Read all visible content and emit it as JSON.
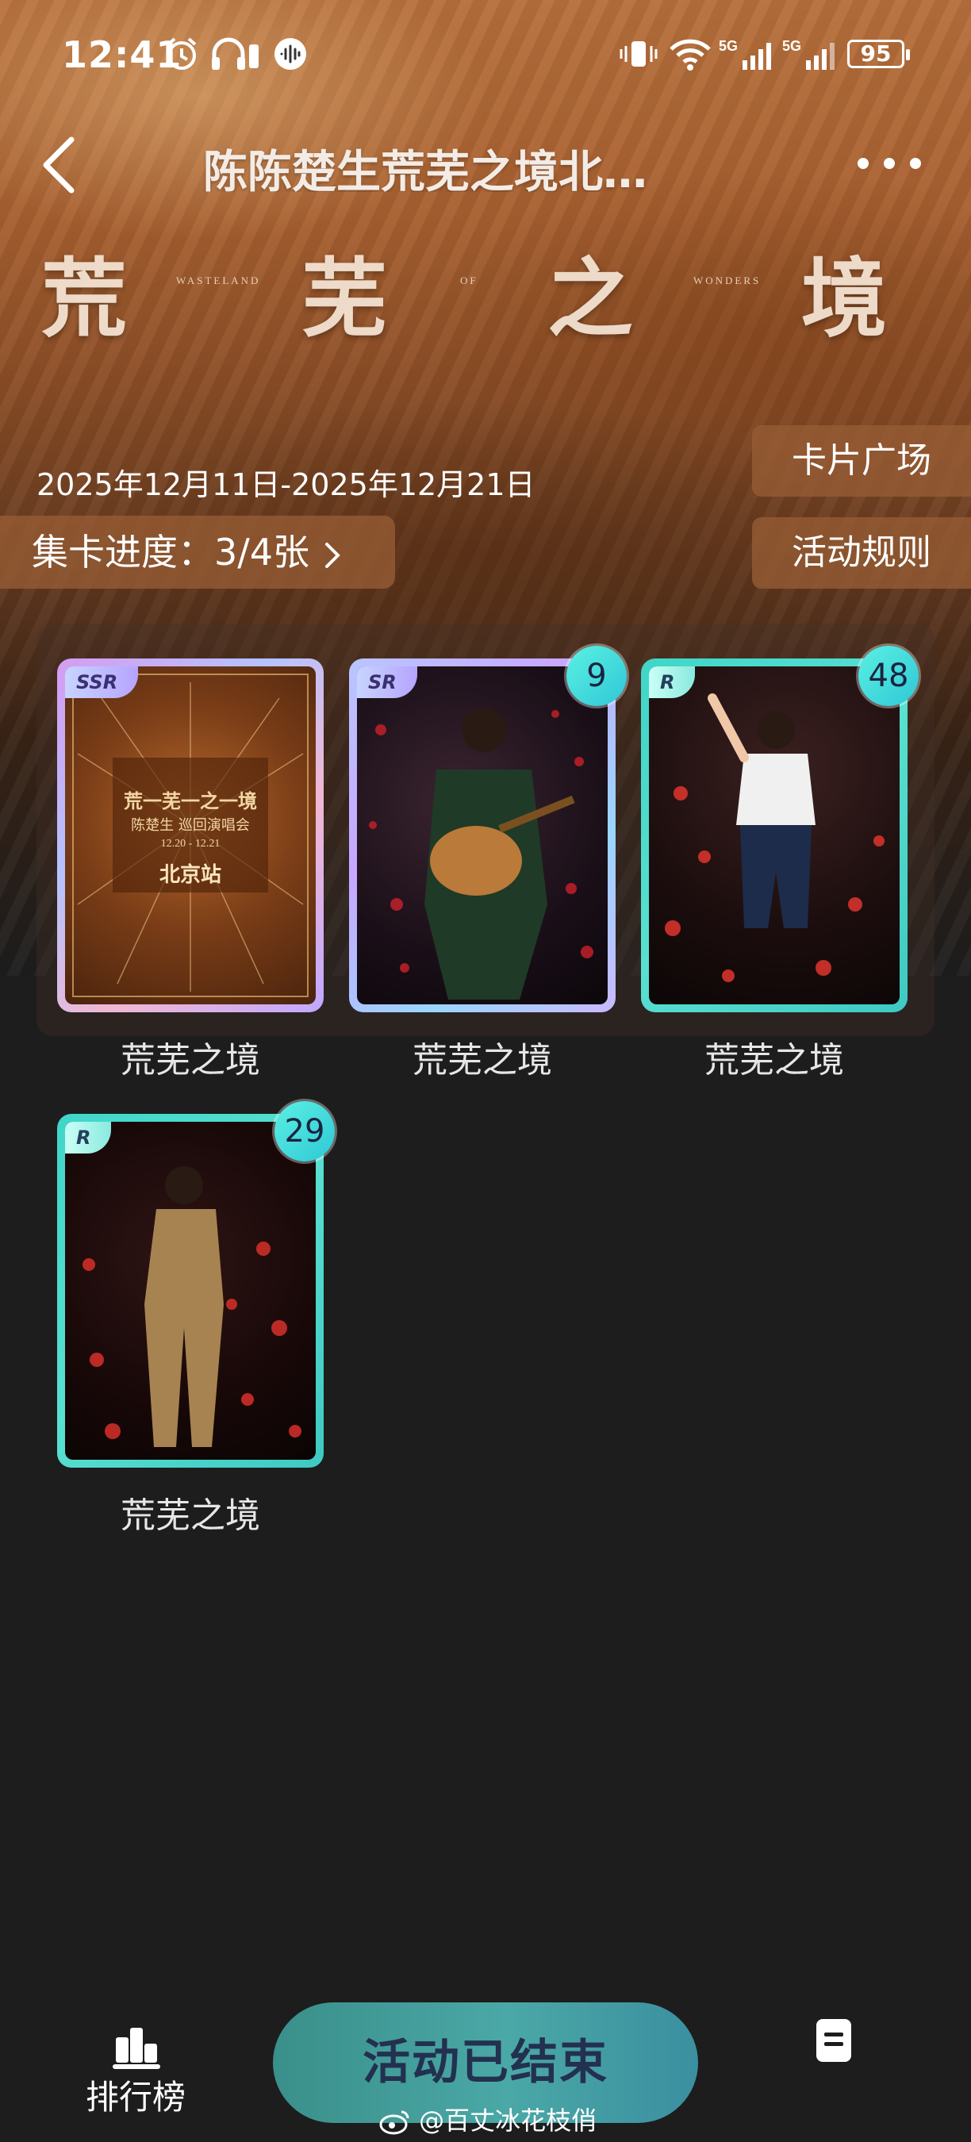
{
  "status_bar": {
    "time": "12:41",
    "battery": "95",
    "network": "5G"
  },
  "header": {
    "title": "陈陈楚生荒芜之境北…"
  },
  "banner": {
    "characters": [
      "荒",
      "芜",
      "之",
      "境"
    ],
    "english_words": [
      "WASTELAND",
      "OF",
      "WONDERS"
    ]
  },
  "event": {
    "date_range": "2025年12月11日-2025年12月21日",
    "progress_label": "集卡进度：3/4张",
    "card_plaza": "卡片广场",
    "rules": "活动规则"
  },
  "cards": [
    {
      "rarity": "SSR",
      "name": "荒芜之境",
      "count": null,
      "poster": {
        "title": "荒一芜一之一境",
        "subtitle": "陈楚生 巡回演唱会",
        "dates": "12.20  -  12.21",
        "station": "北京站"
      }
    },
    {
      "rarity": "SR",
      "name": "荒芜之境",
      "count": "9"
    },
    {
      "rarity": "R",
      "name": "荒芜之境",
      "count": "48"
    },
    {
      "rarity": "R",
      "name": "荒芜之境",
      "count": "29"
    }
  ],
  "bottom_nav": {
    "ranking": "排行榜",
    "end_button": "活动已结束"
  },
  "watermark": "@百丈冰花枝俏",
  "colors": {
    "accent_teal": "#3fd6c8",
    "pill_brown": "#965c34",
    "background": "#1d1d1d"
  }
}
